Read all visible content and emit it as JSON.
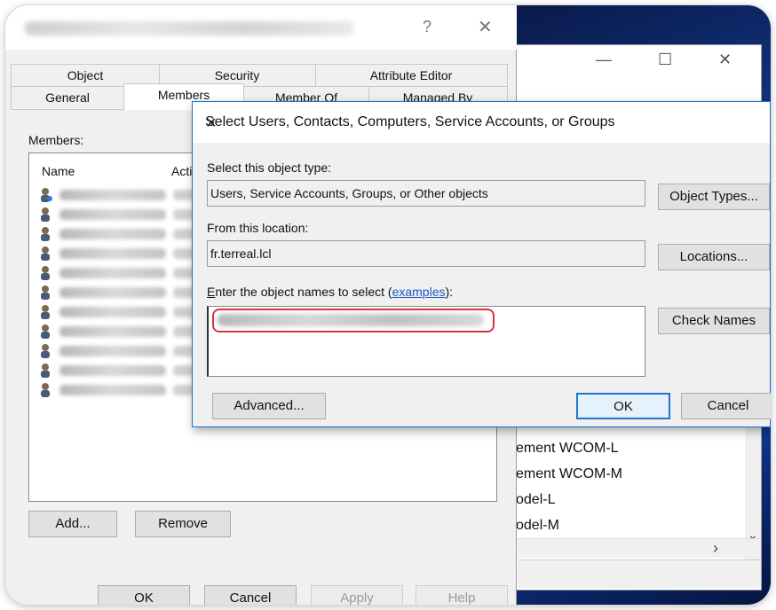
{
  "properties": {
    "tabs_row1": [
      "Object",
      "Security",
      "Attribute Editor"
    ],
    "tabs_row2": [
      "General",
      "Members",
      "Member Of",
      "Managed By"
    ],
    "help_glyph": "?",
    "close_glyph": "✕",
    "members_label": "Members:",
    "columns": [
      "Name",
      "Acti"
    ],
    "add_label": "Add...",
    "remove_label": "Remove",
    "ok_label": "OK",
    "cancel_label": "Cancel",
    "apply_label": "Apply",
    "help_label": "Help"
  },
  "background_window": {
    "minimize_glyph": "—",
    "maximize_glyph": "☐",
    "close_glyph": "✕",
    "items": [
      "ement WCOM-L",
      "ement WCOM-M",
      "odel-L",
      "odel-M"
    ],
    "scroll_down_glyph": "⌄",
    "scroll_right_glyph": "›"
  },
  "select_dialog": {
    "title": "Select Users, Contacts, Computers, Service Accounts, or Groups",
    "close_glyph": "✕",
    "object_type_label": "Select this object type:",
    "object_type_value": "Users, Service Accounts, Groups, or Other objects",
    "object_types_button": "Object Types...",
    "location_label": "From this location:",
    "location_value": "fr.terreal.lcl",
    "locations_button": "Locations...",
    "names_label_prefix": "nter the object names to select (",
    "names_label_first_letter": "E",
    "names_label_link": "examples",
    "names_label_suffix": "):",
    "check_names_button": "Check Names",
    "advanced_button": "Advanced...",
    "ok_button": "OK",
    "cancel_button": "Cancel"
  }
}
